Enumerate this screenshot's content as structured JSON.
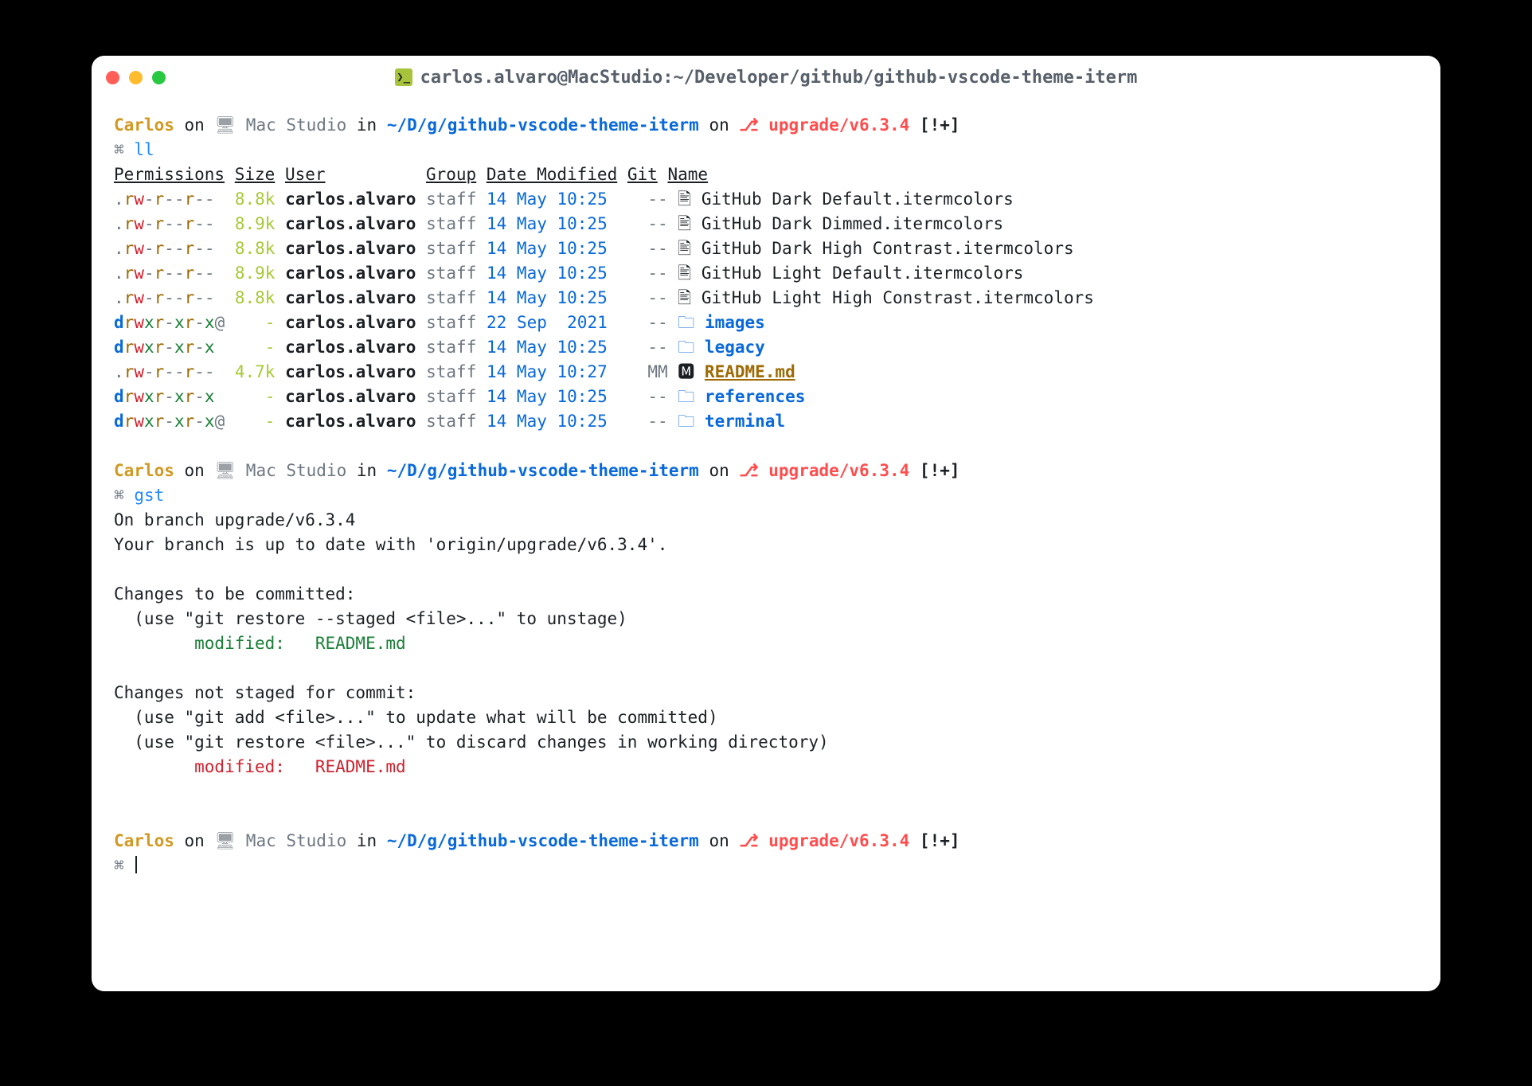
{
  "window": {
    "title": "carlos.alvaro@MacStudio:~/Developer/github/github-vscode-theme-iterm"
  },
  "prompt": {
    "user": "Carlos",
    "on": "on",
    "host_icon": "⌂",
    "host": "Mac Studio",
    "in": "in",
    "path": "~/D/g/github-vscode-theme-iterm",
    "on2": "on",
    "git_icon": "⎇",
    "branch": "upgrade/v6.3.4",
    "flags": "[!+]",
    "symbol": "⌘"
  },
  "cmds": {
    "ll": "ll",
    "gst": "gst"
  },
  "ls": {
    "headers": {
      "perm": "Permissions",
      "size": "Size",
      "user": "User",
      "group": "Group",
      "date": "Date Modified",
      "git": "Git",
      "name": "Name"
    },
    "rows": [
      {
        "perm": ".rw-r--r--",
        "size": "8.8k",
        "user": "carlos.alvaro",
        "group": "staff",
        "date": "14 May 10:25",
        "git": "--",
        "icon": "file",
        "name": "GitHub Dark Default.itermcolors",
        "type": "file"
      },
      {
        "perm": ".rw-r--r--",
        "size": "8.9k",
        "user": "carlos.alvaro",
        "group": "staff",
        "date": "14 May 10:25",
        "git": "--",
        "icon": "file",
        "name": "GitHub Dark Dimmed.itermcolors",
        "type": "file"
      },
      {
        "perm": ".rw-r--r--",
        "size": "8.8k",
        "user": "carlos.alvaro",
        "group": "staff",
        "date": "14 May 10:25",
        "git": "--",
        "icon": "file",
        "name": "GitHub Dark High Contrast.itermcolors",
        "type": "file"
      },
      {
        "perm": ".rw-r--r--",
        "size": "8.9k",
        "user": "carlos.alvaro",
        "group": "staff",
        "date": "14 May 10:25",
        "git": "--",
        "icon": "file",
        "name": "GitHub Light Default.itermcolors",
        "type": "file"
      },
      {
        "perm": ".rw-r--r--",
        "size": "8.8k",
        "user": "carlos.alvaro",
        "group": "staff",
        "date": "14 May 10:25",
        "git": "--",
        "icon": "file",
        "name": "GitHub Light High Constrast.itermcolors",
        "type": "file"
      },
      {
        "perm": "drwxr-xr-x@",
        "size": "-",
        "user": "carlos.alvaro",
        "group": "staff",
        "date": "22 Sep  2021",
        "git": "--",
        "icon": "dir",
        "name": "images",
        "type": "dir"
      },
      {
        "perm": "drwxr-xr-x",
        "size": "-",
        "user": "carlos.alvaro",
        "group": "staff",
        "date": "14 May 10:25",
        "git": "--",
        "icon": "dir",
        "name": "legacy",
        "type": "dir"
      },
      {
        "perm": ".rw-r--r--",
        "size": "4.7k",
        "user": "carlos.alvaro",
        "group": "staff",
        "date": "14 May 10:27",
        "git": "MM",
        "icon": "md",
        "name": "README.md",
        "type": "readme"
      },
      {
        "perm": "drwxr-xr-x",
        "size": "-",
        "user": "carlos.alvaro",
        "group": "staff",
        "date": "14 May 10:25",
        "git": "--",
        "icon": "dir",
        "name": "references",
        "type": "dir"
      },
      {
        "perm": "drwxr-xr-x@",
        "size": "-",
        "user": "carlos.alvaro",
        "group": "staff",
        "date": "14 May 10:25",
        "git": "--",
        "icon": "dir",
        "name": "terminal",
        "type": "dir"
      }
    ]
  },
  "gst": {
    "l1": "On branch upgrade/v6.3.4",
    "l2": "Your branch is up to date with 'origin/upgrade/v6.3.4'.",
    "h1": "Changes to be committed:",
    "h1hint": "  (use \"git restore --staged <file>...\" to unstage)",
    "staged": "        modified:   README.md",
    "h2": "Changes not staged for commit:",
    "h2hint1": "  (use \"git add <file>...\" to update what will be committed)",
    "h2hint2": "  (use \"git restore <file>...\" to discard changes in working directory)",
    "unstaged": "        modified:   README.md"
  }
}
